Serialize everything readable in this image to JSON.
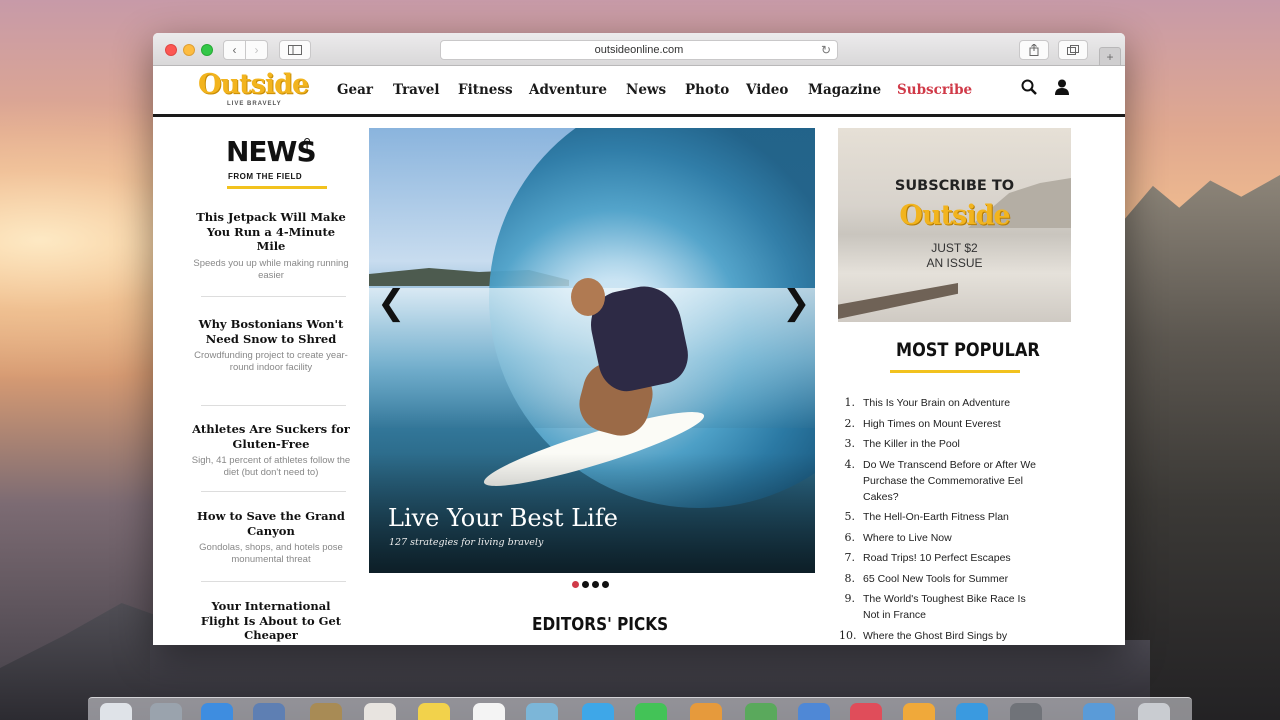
{
  "browser": {
    "url": "outsideonline.com",
    "back_label": "‹",
    "forward_label": "›"
  },
  "site": {
    "logo": "Outside",
    "tagline": "LIVE BRAVELY",
    "nav": [
      "Gear",
      "Travel",
      "Fitness",
      "Adventure",
      "News",
      "Photo",
      "Video",
      "Magazine"
    ],
    "subscribe": "Subscribe",
    "accent_color": "#f2b41e",
    "subscribe_color": "#d03a48"
  },
  "news": {
    "logo_main": "NEWS",
    "logo_sub": "FROM THE FIELD",
    "stories": [
      {
        "title": "This Jetpack Will Make You Run a 4-Minute Mile",
        "desc": "Speeds you up while making running easier"
      },
      {
        "title": "Why Bostonians Won't Need Snow to Shred",
        "desc": "Crowdfunding project to create year-round indoor facility"
      },
      {
        "title": "Athletes Are Suckers for Gluten-Free",
        "desc": "Sigh, 41 percent of athletes follow the diet (but don't need to)"
      },
      {
        "title": "How to Save the Grand Canyon",
        "desc": "Gondolas, shops, and hotels pose monumental threat"
      },
      {
        "title": "Your International Flight Is About to Get Cheaper",
        "desc": ""
      }
    ]
  },
  "hero": {
    "title": "Live Your Best Life",
    "subtitle": "127 strategies for living bravely",
    "prev": "❮",
    "next": "❯",
    "slides": 4,
    "active_slide": 1
  },
  "editors_picks": "EDITORS' PICKS",
  "ad": {
    "line1": "SUBSCRIBE TO",
    "logo": "Outside",
    "line2": "JUST $2",
    "line3": "AN ISSUE"
  },
  "most_popular": {
    "title": "MOST POPULAR",
    "items": [
      {
        "num": "1.",
        "text": "This Is Your Brain on Adventure"
      },
      {
        "num": "2.",
        "text": "High Times on Mount Everest"
      },
      {
        "num": "3.",
        "text": "The Killer in the Pool"
      },
      {
        "num": "4.",
        "text": "Do We Transcend Before or After We Purchase the Commemorative Eel Cakes?"
      },
      {
        "num": "5.",
        "text": "The Hell-On-Earth Fitness Plan"
      },
      {
        "num": "6.",
        "text": "Where to Live Now"
      },
      {
        "num": "7.",
        "text": "Road Trips! 10 Perfect Escapes"
      },
      {
        "num": "8.",
        "text": "65 Cool New Tools for Summer"
      },
      {
        "num": "9.",
        "text": "The World's Toughest Bike Race Is Not in France"
      },
      {
        "num": "10.",
        "text": "Where the Ghost Bird Sings by"
      }
    ]
  },
  "icons": {
    "search": "search-icon",
    "account": "user-icon",
    "share": "share-icon",
    "tabs": "tabs-icon",
    "reload": "reload-icon",
    "sidebar": "sidebar-icon"
  }
}
